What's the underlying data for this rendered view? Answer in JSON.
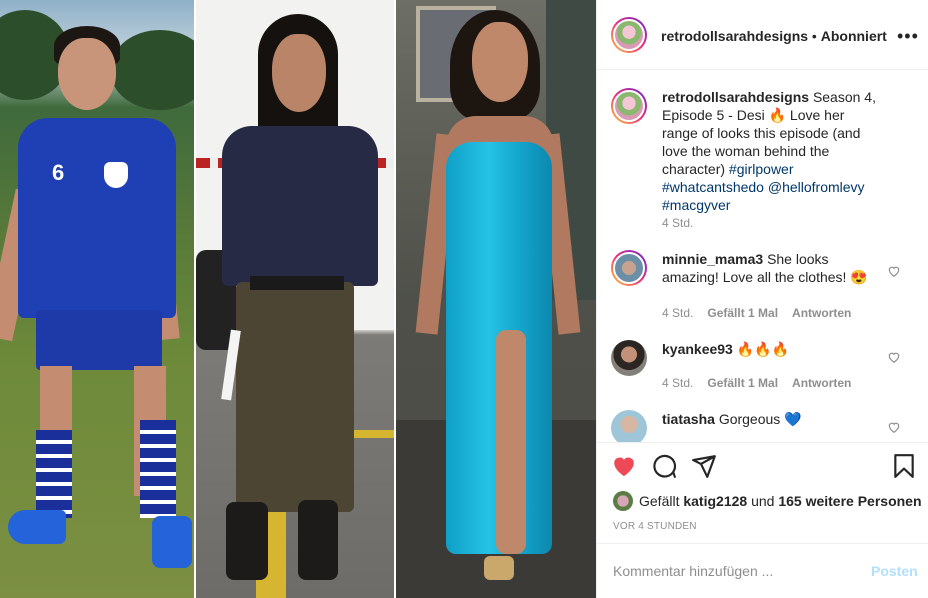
{
  "post": {
    "images": [
      "soccer-outfit-photo",
      "cargo-outfit-photo",
      "blue-gown-photo"
    ],
    "jersey_number": "6"
  },
  "header": {
    "username": "retrodollsarahdesigns",
    "separator": " • ",
    "follow_state": "Abonniert",
    "more_icon": "more-options-icon"
  },
  "caption": {
    "username": "retrodollsarahdesigns",
    "text": "Season 4, Episode 5 - Desi 🔥 Love her range of looks this episode (and love the woman behind the character)",
    "tags": [
      "#girlpower",
      "#whatcantshedo",
      "@hellofromlevy",
      "#macgyver"
    ],
    "time": "4 Std."
  },
  "comments": [
    {
      "username": "minnie_mama3",
      "text": "She looks amazing! Love all the clothes! 😍",
      "time": "4 Std.",
      "likes": "Gefällt 1 Mal",
      "reply": "Antworten"
    },
    {
      "username": "kyankee93",
      "text": "🔥🔥🔥",
      "time": "4 Std.",
      "likes": "Gefällt 1 Mal",
      "reply": "Antworten"
    },
    {
      "username": "tiatasha",
      "text": "Gorgeous 💙",
      "time": "",
      "likes": "",
      "reply": ""
    }
  ],
  "actions": {
    "like_icon": "heart-filled-icon",
    "comment_icon": "comment-icon",
    "share_icon": "share-icon",
    "save_icon": "bookmark-icon",
    "like_color": "#ed4956"
  },
  "likes": {
    "prefix": "Gefällt ",
    "user": "katig2128",
    "middle": " und ",
    "others": "165 weitere Personen"
  },
  "timestamp": "VOR 4 STUNDEN",
  "add_comment": {
    "placeholder": "Kommentar hinzufügen ...",
    "post_label": "Posten"
  }
}
